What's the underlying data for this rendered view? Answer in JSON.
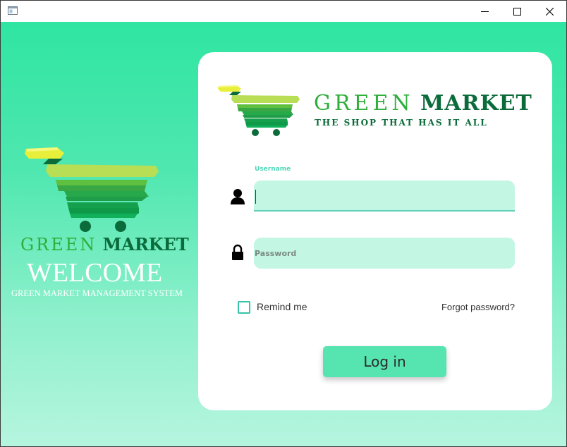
{
  "window": {
    "controls": {
      "minimize_icon": "minimize-icon",
      "maximize_icon": "maximize-icon",
      "close_icon": "close-icon"
    }
  },
  "branding": {
    "brand_first": "GREEN",
    "brand_second": "MARKET",
    "welcome": "WELCOME",
    "welcome_subtitle": "GREEN MARKET MANAGEMENT SYSTEM",
    "tagline": "THE SHOP THAT HAS IT ALL",
    "logo_icon": "shopping-cart-logo"
  },
  "login_form": {
    "username_label": "Username",
    "username_value": "",
    "password_placeholder": "Password",
    "password_value": "",
    "user_icon": "user-icon",
    "lock_icon": "lock-icon",
    "remember_label": "Remind me",
    "remember_checked": false,
    "forgot_password": "Forgot password?",
    "login_button": "Log in"
  },
  "colors": {
    "accent": "#56e4b1",
    "input_background": "#c4f7e3",
    "brand_light_green": "#2fae3a",
    "brand_dark_green": "#0b6b3a",
    "background_top": "#2fe5a1",
    "background_bottom": "#b6f5df"
  }
}
